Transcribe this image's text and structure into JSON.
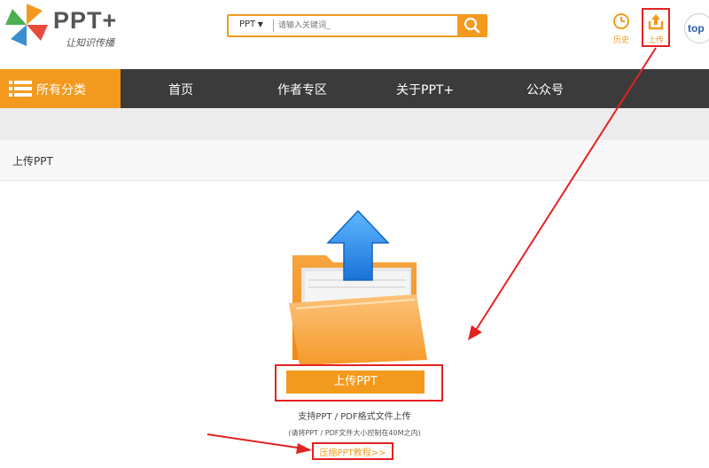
{
  "header": {
    "logo_text": "PPT+",
    "logo_slogan": "让知识传播",
    "search": {
      "type_label": "PPT",
      "placeholder": "请输入关键词_"
    },
    "history_label": "历史",
    "upload_label": "上传",
    "avatar_text": "top"
  },
  "nav": {
    "categories_label": "所有分类",
    "items": [
      "首页",
      "作者专区",
      "关于PPT+",
      "公众号"
    ]
  },
  "subheader": {
    "title": "上传PPT"
  },
  "main": {
    "upload_button": "上传PPT",
    "hint_formats": "支持PPT / PDF格式文件上传",
    "hint_size": "(请将PPT / PDF文件大小控制在40M之内)",
    "tutorial_link": "压缩PPT教程>>"
  },
  "colors": {
    "accent": "#f39a1e",
    "nav_bg": "#3b3b3b",
    "annotation_red": "#e32222"
  }
}
